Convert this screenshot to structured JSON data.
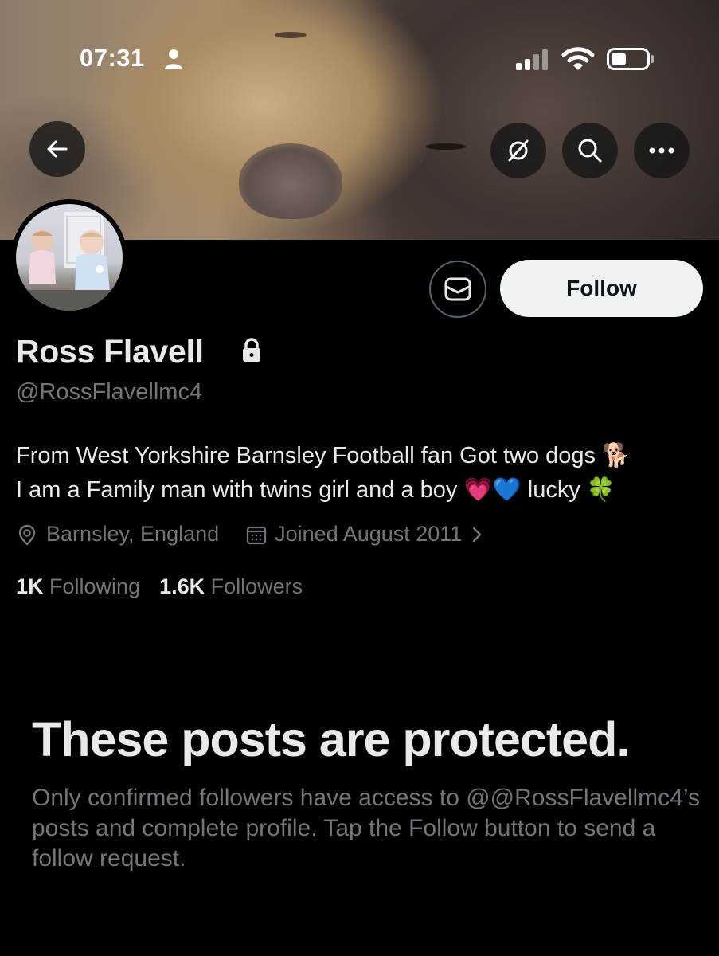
{
  "status_bar": {
    "time": "07:31"
  },
  "banner": {
    "back_icon": "arrow-left-icon",
    "actions": [
      "grok-icon",
      "search-icon",
      "more-icon"
    ]
  },
  "profile": {
    "message_icon": "envelope-icon",
    "follow_label": "Follow",
    "display_name": "Ross Flavell",
    "lock_icon": "lock-icon",
    "handle": "@RossFlavellmc4",
    "bio": {
      "line1": "From West Yorkshire Barnsley Football fan Got two dogs 🐕",
      "line2": "I am a Family man with twins girl and a boy 💗💙 lucky 🍀"
    },
    "location": "Barnsley, England",
    "joined": "Joined August 2011",
    "following_count": "1K",
    "following_label": "Following",
    "followers_count": "1.6K",
    "followers_label": "Followers"
  },
  "protected": {
    "title": "These posts are protected.",
    "body": "Only confirmed followers have access to @@RossFlavellmc4’s posts and complete profile. Tap the Follow button to send a follow request."
  },
  "colors": {
    "background": "#000000",
    "text_primary": "#e7e9ea",
    "text_secondary": "#71767b",
    "follow_button_bg": "#eff3f4"
  }
}
